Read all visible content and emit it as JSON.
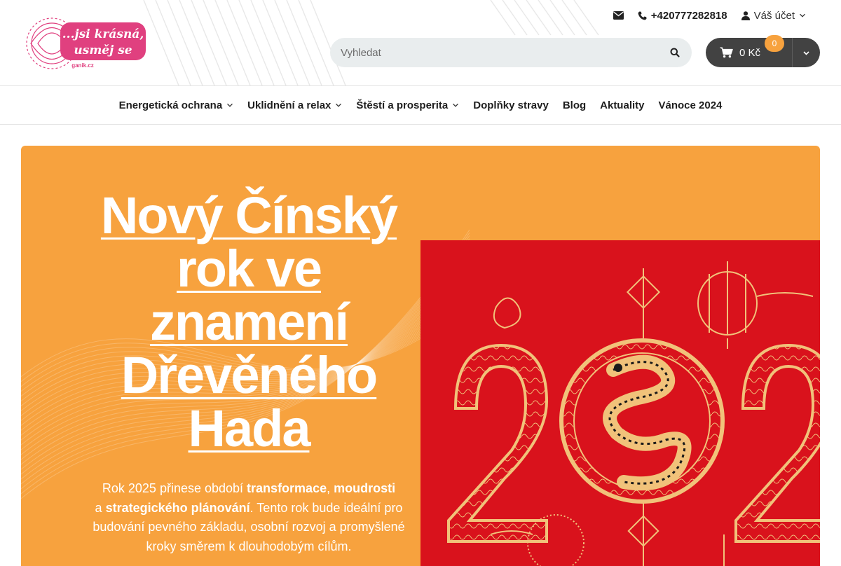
{
  "header": {
    "logo": {
      "line1": "...jsi krásná,",
      "line2": "usměj se",
      "domain": "ganik.cz"
    },
    "phone": "+420777282818",
    "account_label": "Váš účet",
    "search": {
      "placeholder": "Vyhledat",
      "value": ""
    },
    "cart": {
      "total": "0 Kč",
      "count": "0"
    }
  },
  "nav": {
    "items": [
      {
        "label": "Energetická ochrana",
        "has_submenu": true
      },
      {
        "label": "Uklidnění a relax",
        "has_submenu": true
      },
      {
        "label": "Štěstí a prosperita",
        "has_submenu": true
      },
      {
        "label": "Doplňky stravy",
        "has_submenu": false
      },
      {
        "label": "Blog",
        "has_submenu": false
      },
      {
        "label": "Aktuality",
        "has_submenu": false
      },
      {
        "label": "Vánoce 2024",
        "has_submenu": false
      }
    ]
  },
  "hero": {
    "title_lines": [
      "Nový Čínský",
      "rok ve",
      "znamení",
      "Dřevěného",
      "Hada"
    ],
    "text": {
      "p1": "Rok 2025 přinese období ",
      "b1": "transformace",
      "p2": ", ",
      "b2": "moudrosti",
      "p3": " a ",
      "b3": "strategického plánování",
      "p4": ". Tento rok bude ideální pro budování pevného základu, osobní rozvoj a promyšlené kroky směrem k dlouhodobým cílům."
    },
    "promo_image": {
      "digits": "202"
    }
  },
  "colors": {
    "accent_orange": "#f7a23e",
    "logo_pink": "#e0407f",
    "promo_red": "#d9121c",
    "promo_gold": "#f1c27a",
    "cart_dark": "#424242"
  },
  "icons": [
    "envelope-icon",
    "phone-icon",
    "user-icon",
    "chevron-down-icon",
    "search-icon",
    "cart-icon"
  ]
}
